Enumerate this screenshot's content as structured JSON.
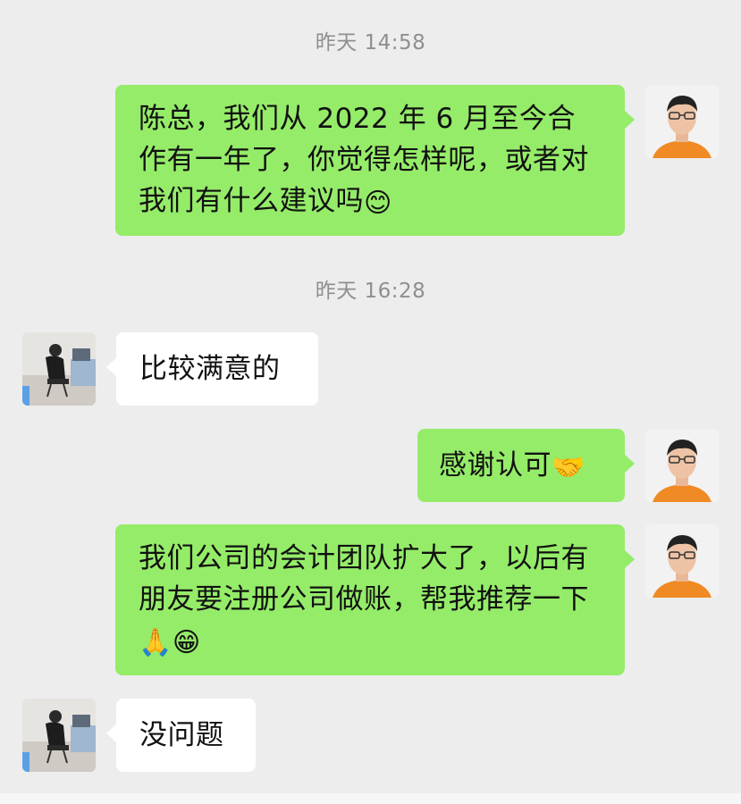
{
  "timestamps": [
    "昨天 14:58",
    "昨天 16:28"
  ],
  "messages": [
    {
      "sender": "me",
      "text": "陈总，我们从 2022 年 6 月至今合作有一年了，你觉得怎样呢，或者对我们有什么建议吗",
      "emoji": "😊"
    },
    {
      "sender": "other",
      "text": "比较满意的",
      "emoji": ""
    },
    {
      "sender": "me",
      "text": "感谢认可",
      "emoji": "🤝"
    },
    {
      "sender": "me",
      "text": "我们公司的会计团队扩大了，以后有朋友要注册公司做账，帮我推荐一下",
      "emoji": "🙏😁"
    },
    {
      "sender": "other",
      "text": "没问题",
      "emoji": ""
    }
  ],
  "colors": {
    "background": "#ededed",
    "bubble_me": "#95ec69",
    "bubble_other": "#ffffff",
    "timestamp": "#8f8f8f"
  }
}
